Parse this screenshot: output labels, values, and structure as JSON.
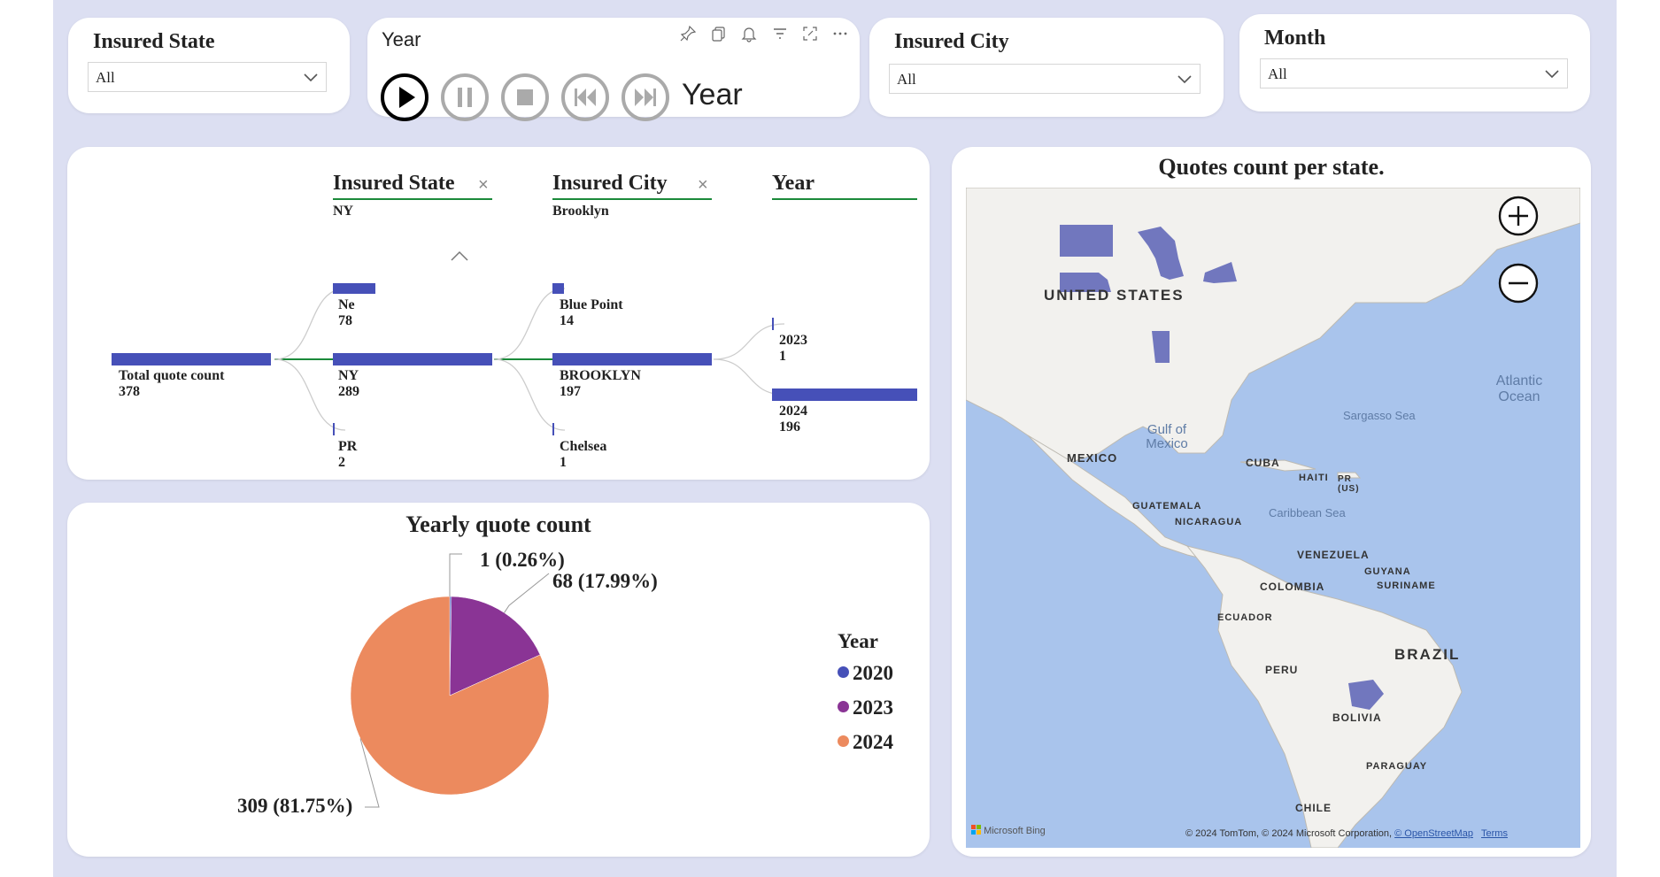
{
  "slicers": {
    "insured_state": {
      "title": "Insured State",
      "value": "All"
    },
    "year_player": {
      "title": "Year",
      "label": "Year"
    },
    "insured_city": {
      "title": "Insured City",
      "value": "All"
    },
    "month": {
      "title": "Month",
      "value": "All"
    }
  },
  "tree": {
    "headers": [
      {
        "title": "Insured State",
        "selected": "NY"
      },
      {
        "title": "Insured City",
        "selected": "Brooklyn"
      },
      {
        "title": "Year"
      }
    ],
    "root": {
      "label": "Total quote count",
      "value": 378
    },
    "state_nodes": [
      {
        "label": "Ne",
        "value": 78
      },
      {
        "label": "NY",
        "value": 289
      },
      {
        "label": "PR",
        "value": 2
      }
    ],
    "city_nodes": [
      {
        "label": "Blue Point",
        "value": 14
      },
      {
        "label": "BROOKLYN",
        "value": 197
      },
      {
        "label": "Chelsea",
        "value": 1
      }
    ],
    "year_nodes": [
      {
        "label": "2023",
        "value": 1
      },
      {
        "label": "2024",
        "value": 196
      }
    ]
  },
  "pie": {
    "title": "Yearly quote count",
    "legend_title": "Year",
    "labels": [
      "1 (0.26%)",
      "68 (17.99%)",
      "309 (81.75%)"
    ]
  },
  "chart_data": {
    "type": "pie",
    "title": "Yearly quote count",
    "categories": [
      "2020",
      "2023",
      "2024"
    ],
    "values": [
      1,
      68,
      309
    ],
    "percentages": [
      0.26,
      17.99,
      81.75
    ],
    "colors": [
      "#4650b8",
      "#8a3495",
      "#ec8a5e"
    ],
    "legend": "right"
  },
  "map": {
    "title": "Quotes count per state.",
    "labels": {
      "us": "UNITED STATES",
      "mexico": "MEXICO",
      "gulf": "Gulf of Mexico",
      "cuba": "CUBA",
      "haiti": "HAITI",
      "pr": "PR (US)",
      "guatemala": "GUATEMALA",
      "nicaragua": "NICARAGUA",
      "caribbean": "Caribbean Sea",
      "sargasso": "Sargasso Sea",
      "atlantic": "Atlantic Ocean",
      "venezuela": "VENEZUELA",
      "guyana": "GUYANA",
      "suriname": "SURINAME",
      "colombia": "COLOMBIA",
      "ecuador": "ECUADOR",
      "peru": "PERU",
      "brazil": "BRAZIL",
      "bolivia": "BOLIVIA",
      "paraguay": "PARAGUAY",
      "chile": "CHILE"
    },
    "bing": "Microsoft Bing",
    "copyright": "© 2024 TomTom, © 2024 Microsoft Corporation,",
    "osm": "© OpenStreetMap",
    "terms": "Terms",
    "highlight_color": "#5a62b5"
  }
}
